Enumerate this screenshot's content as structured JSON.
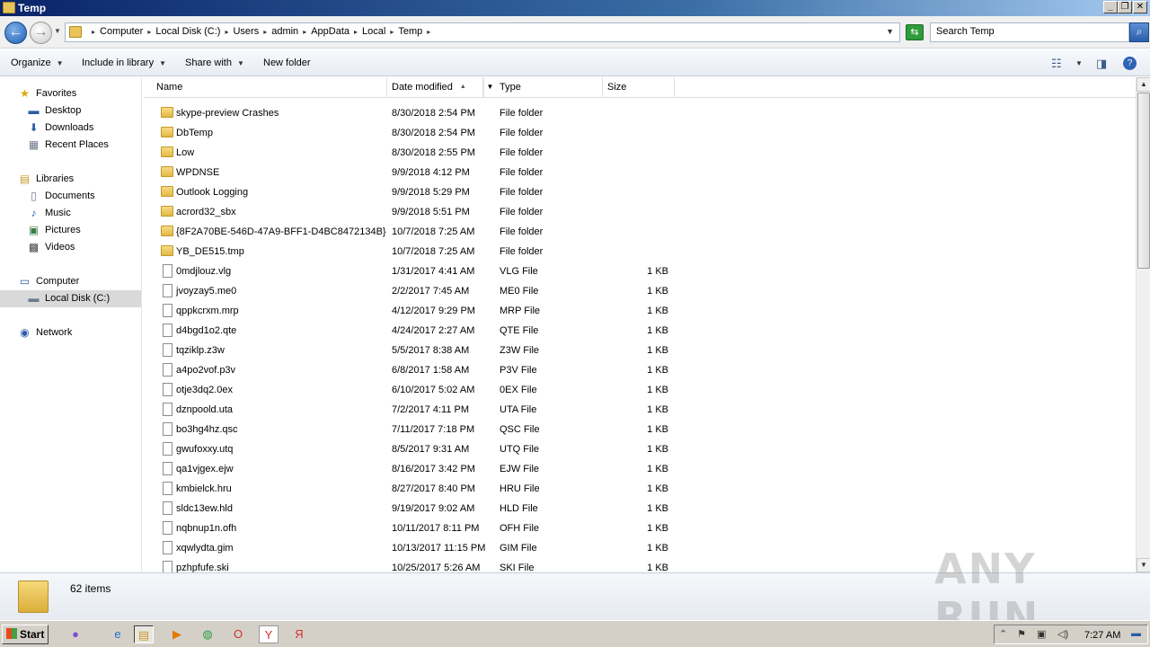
{
  "window": {
    "title": "Temp"
  },
  "address": {
    "crumbs": [
      "Computer",
      "Local Disk (C:)",
      "Users",
      "admin",
      "AppData",
      "Local",
      "Temp"
    ]
  },
  "search": {
    "placeholder": "Search Temp"
  },
  "toolbar": {
    "organize": "Organize",
    "include_in_library": "Include in library",
    "share_with": "Share with",
    "new_folder": "New folder"
  },
  "nav": {
    "favorites": "Favorites",
    "desktop": "Desktop",
    "downloads": "Downloads",
    "recent_places": "Recent Places",
    "libraries": "Libraries",
    "documents": "Documents",
    "music": "Music",
    "pictures": "Pictures",
    "videos": "Videos",
    "computer": "Computer",
    "local_disk": "Local Disk (C:)",
    "network": "Network"
  },
  "columns": {
    "name": "Name",
    "date": "Date modified",
    "type": "Type",
    "size": "Size"
  },
  "files": [
    {
      "name": "skype-preview Crashes",
      "date": "8/30/2018 2:54 PM",
      "type": "File folder",
      "size": "",
      "kind": "folder"
    },
    {
      "name": "DbTemp",
      "date": "8/30/2018 2:54 PM",
      "type": "File folder",
      "size": "",
      "kind": "folder"
    },
    {
      "name": "Low",
      "date": "8/30/2018 2:55 PM",
      "type": "File folder",
      "size": "",
      "kind": "folder"
    },
    {
      "name": "WPDNSE",
      "date": "9/9/2018 4:12 PM",
      "type": "File folder",
      "size": "",
      "kind": "folder"
    },
    {
      "name": "Outlook Logging",
      "date": "9/9/2018 5:29 PM",
      "type": "File folder",
      "size": "",
      "kind": "folder"
    },
    {
      "name": "acrord32_sbx",
      "date": "9/9/2018 5:51 PM",
      "type": "File folder",
      "size": "",
      "kind": "folder"
    },
    {
      "name": "{8F2A70BE-546D-47A9-BFF1-D4BC8472134B}",
      "date": "10/7/2018 7:25 AM",
      "type": "File folder",
      "size": "",
      "kind": "folder"
    },
    {
      "name": "YB_DE515.tmp",
      "date": "10/7/2018 7:25 AM",
      "type": "File folder",
      "size": "",
      "kind": "folder"
    },
    {
      "name": "0mdjlouz.vlg",
      "date": "1/31/2017 4:41 AM",
      "type": "VLG File",
      "size": "1 KB",
      "kind": "file"
    },
    {
      "name": "jvoyzay5.me0",
      "date": "2/2/2017 7:45 AM",
      "type": "ME0 File",
      "size": "1 KB",
      "kind": "file"
    },
    {
      "name": "qppkcrxm.mrp",
      "date": "4/12/2017 9:29 PM",
      "type": "MRP File",
      "size": "1 KB",
      "kind": "file"
    },
    {
      "name": "d4bgd1o2.qte",
      "date": "4/24/2017 2:27 AM",
      "type": "QTE File",
      "size": "1 KB",
      "kind": "file"
    },
    {
      "name": "tqziklp.z3w",
      "date": "5/5/2017 8:38 AM",
      "type": "Z3W File",
      "size": "1 KB",
      "kind": "file"
    },
    {
      "name": "a4po2vof.p3v",
      "date": "6/8/2017 1:58 AM",
      "type": "P3V File",
      "size": "1 KB",
      "kind": "file"
    },
    {
      "name": "otje3dq2.0ex",
      "date": "6/10/2017 5:02 AM",
      "type": "0EX File",
      "size": "1 KB",
      "kind": "file"
    },
    {
      "name": "dznpoold.uta",
      "date": "7/2/2017 4:11 PM",
      "type": "UTA File",
      "size": "1 KB",
      "kind": "file"
    },
    {
      "name": "bo3hg4hz.qsc",
      "date": "7/11/2017 7:18 PM",
      "type": "QSC File",
      "size": "1 KB",
      "kind": "file"
    },
    {
      "name": "gwufoxxy.utq",
      "date": "8/5/2017 9:31 AM",
      "type": "UTQ File",
      "size": "1 KB",
      "kind": "file"
    },
    {
      "name": "qa1vjgex.ejw",
      "date": "8/16/2017 3:42 PM",
      "type": "EJW File",
      "size": "1 KB",
      "kind": "file"
    },
    {
      "name": "kmbielck.hru",
      "date": "8/27/2017 8:40 PM",
      "type": "HRU File",
      "size": "1 KB",
      "kind": "file"
    },
    {
      "name": "sldc13ew.hld",
      "date": "9/19/2017 9:02 AM",
      "type": "HLD File",
      "size": "1 KB",
      "kind": "file"
    },
    {
      "name": "nqbnup1n.ofh",
      "date": "10/11/2017 8:11 PM",
      "type": "OFH File",
      "size": "1 KB",
      "kind": "file"
    },
    {
      "name": "xqwlydta.gim",
      "date": "10/13/2017 11:15 PM",
      "type": "GIM File",
      "size": "1 KB",
      "kind": "file"
    },
    {
      "name": "pzhpfufe.ski",
      "date": "10/25/2017 5:26 AM",
      "type": "SKI File",
      "size": "1 KB",
      "kind": "file"
    }
  ],
  "details": {
    "item_count": "62 items"
  },
  "watermark": "ANY RUN",
  "taskbar": {
    "start": "Start",
    "clock": "7:27 AM"
  }
}
